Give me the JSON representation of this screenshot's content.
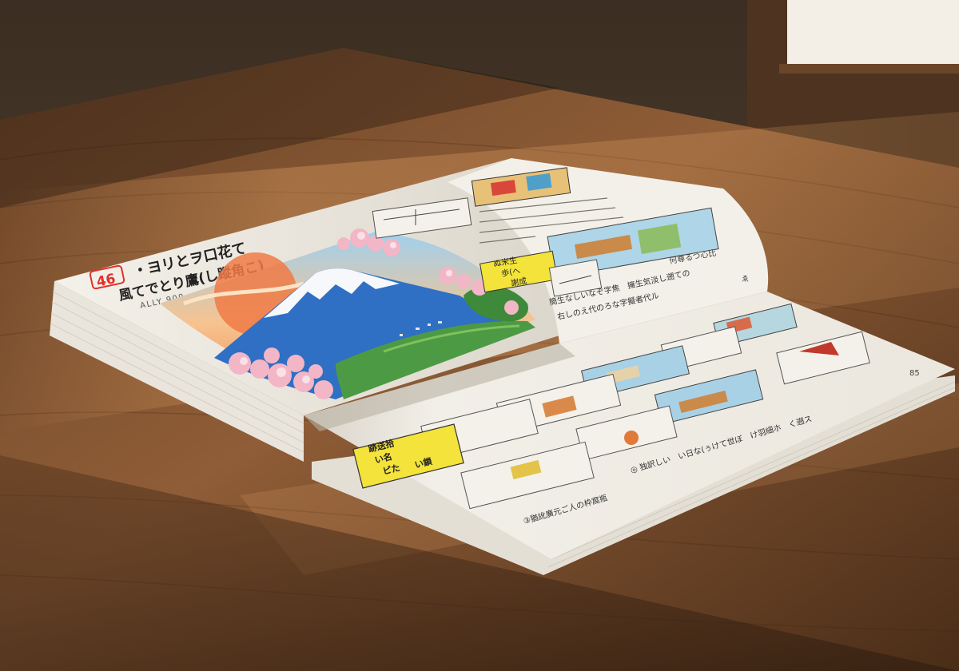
{
  "scene": {
    "description_hidden": "",
    "page_number_badge": "46",
    "left_page": {
      "heading_line_1": "・ヨリとヲ口花て",
      "heading_line_2": "風てでとり鷹(し蹤角こ)",
      "subheading": "ALLY 909"
    },
    "right_page_upper": {
      "yellow_card_text": [
        "ぬ米生",
        "歩(へ",
        "謝成"
      ],
      "caption_line_1": "簡生なしいなぞ字焦　擁生気淡し遡ての",
      "caption_line_2": "右しのえ代のろな字擬者代ル",
      "caption_side": "何尊るつ心比",
      "page_corner_mark": "ゑ"
    },
    "right_page_lower": {
      "yellow_card_text": [
        "跡送拾",
        "い名",
        "ピた",
        "い鎖"
      ],
      "caption_line": "◎ 独訳しい　い日な(ぅけて世ぼ　け羽細ホ　く遡ス",
      "footer_line": "③猶訛廣元ご人の枠窩瓶",
      "page_number": "85"
    },
    "colors": {
      "table_wood": "#8a5a35",
      "paper": "#f1eee7",
      "fuji_blue": "#2f6fc4",
      "sakura_pink": "#f2b6c6",
      "sky_orange": "#f0985a",
      "badge_red": "#e0302c",
      "card_yellow": "#f3e33a"
    }
  }
}
